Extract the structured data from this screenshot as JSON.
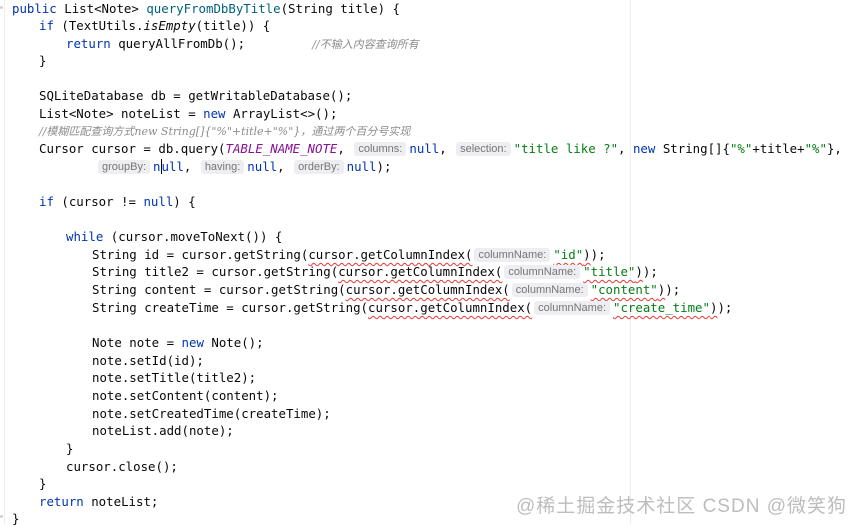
{
  "editor": {
    "lines": {
      "l1": {
        "kw_public": "public",
        "type_list": "List<Note>",
        "method_name": "queryFromDbByTitle",
        "params": "(String title) {"
      },
      "l2": {
        "kw_if": "if",
        "open": " (TextUtils.",
        "is_empty": "isEmpty",
        "rest": "(title)) {"
      },
      "l3": {
        "kw_return": "return",
        "call": " queryAllFromDb();",
        "comment": "//不输入内容查询所有"
      },
      "l4": {
        "text": "}"
      },
      "l5": {
        "text": "SQLiteDatabase db = getWritableDatabase();"
      },
      "l6": {
        "start": "List<Note> noteList = ",
        "kw_new": "new",
        "rest": " ArrayList<>();"
      },
      "l7": {
        "comment": "//模糊匹配查询方式new String[]{\"%\"+title+\"%\"}，通过两个百分号实现"
      },
      "l8": {
        "start": "Cursor cursor = db.query(",
        "table_const": "TABLE_NAME_NOTE",
        "comma1": ", ",
        "hint_columns": "columns:",
        "null1": "null",
        "comma2": ", ",
        "hint_selection": "selection:",
        "selection_str": "\"title like ?\"",
        "comma3": ", ",
        "kw_new": "new",
        "string_arr": " String[]{",
        "pct1": "\"%\"",
        "plus_title": "+title+",
        "pct2": "\"%\"",
        "end": "},"
      },
      "l9": {
        "hint_groupby": "groupBy:",
        "null_a1": "n",
        "null_a2": "ull",
        "comma1": ", ",
        "hint_having": "having:",
        "null_b": "null",
        "comma2": ", ",
        "hint_orderby": "orderBy:",
        "null_c": "null",
        "end": ");"
      },
      "l10": {
        "kw_if": "if",
        "start": " (cursor != ",
        "kw_null": "null",
        "end": ") {"
      },
      "l11": {
        "kw_while": "while",
        "rest": " (cursor.moveToNext()) {"
      },
      "l12": {
        "start": "String id = cursor.getString(",
        "squig": "cursor.getColumnIndex(",
        "hint": "columnName:",
        "str": "\"id\"",
        "squig_end": ")",
        "end": ");"
      },
      "l13": {
        "start": "String title2 = cursor.getString(",
        "squig": "cursor.getColumnIndex(",
        "hint": "columnName:",
        "str": "\"title\"",
        "squig_end": ")",
        "end": ");"
      },
      "l14": {
        "start": "String content = cursor.getString(",
        "squig": "cursor.getColumnIndex(",
        "hint": "columnName:",
        "str": "\"content\"",
        "squig_end": ")",
        "end": ");"
      },
      "l15": {
        "start": "String createTime = cursor.getString(",
        "squig": "cursor.getColumnIndex(",
        "hint": "columnName:",
        "str": "\"create_time\"",
        "squig_end": ")",
        "end": ");"
      },
      "l16": {
        "start": "Note note = ",
        "kw_new": "new",
        "rest": " Note();"
      },
      "l17": {
        "text": "note.setId(id);"
      },
      "l18": {
        "text": "note.setTitle(title2);"
      },
      "l19": {
        "text": "note.setContent(content);"
      },
      "l20": {
        "text": "note.setCreatedTime(createTime);"
      },
      "l21": {
        "text": "noteList.add(note);"
      },
      "l22": {
        "text": "}"
      },
      "l23": {
        "text": "cursor.close();"
      },
      "l24": {
        "text": "}"
      },
      "l25": {
        "kw_return": "return",
        "rest": " noteList;"
      },
      "l26": {
        "text": "}"
      }
    }
  },
  "watermark": {
    "text": "@稀土掘金技术社区  CSDN @微笑狗"
  },
  "colors": {
    "keyword": "#0033b3",
    "method": "#00627a",
    "constant": "#871094",
    "string": "#067d17",
    "comment": "#8c8c8c",
    "hint_bg": "#eeeef2",
    "error": "#e53935"
  }
}
